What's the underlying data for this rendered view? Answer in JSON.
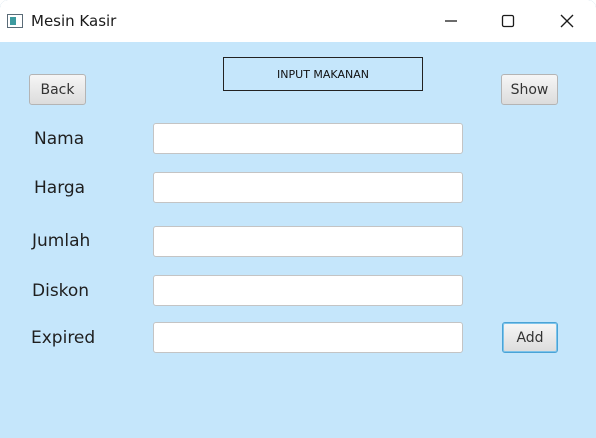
{
  "window": {
    "title": "Mesin Kasir",
    "controls": {
      "minimize_icon": "minimize-icon",
      "maximize_icon": "maximize-icon",
      "close_icon": "close-icon"
    }
  },
  "form": {
    "heading": "INPUT MAKANAN",
    "back_label": "Back",
    "show_label": "Show",
    "add_label": "Add",
    "fields": [
      {
        "label": "Nama",
        "value": "",
        "placeholder": ""
      },
      {
        "label": "Harga",
        "value": "",
        "placeholder": ""
      },
      {
        "label": "Jumlah",
        "value": "",
        "placeholder": ""
      },
      {
        "label": "Diskon",
        "value": "",
        "placeholder": ""
      },
      {
        "label": "Expired",
        "value": "",
        "placeholder": ""
      }
    ]
  },
  "colors": {
    "background": "#c5e6fb",
    "titlebar": "#ffffff",
    "focus": "#4aa3d6"
  }
}
